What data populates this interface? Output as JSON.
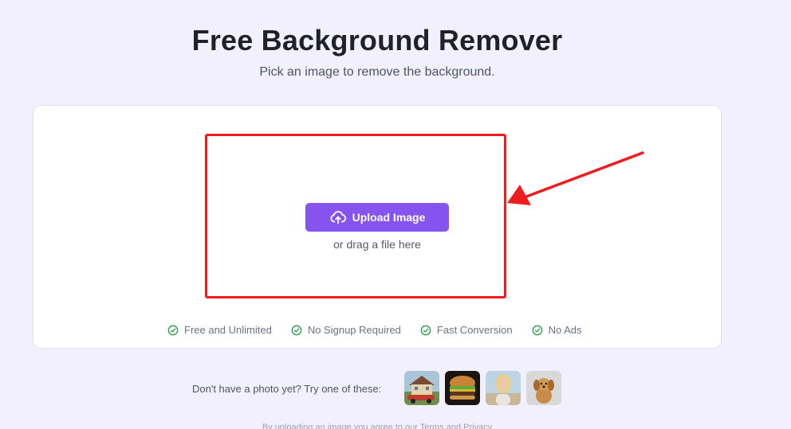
{
  "header": {
    "title": "Free Background Remover",
    "subtitle": "Pick an image to remove the background."
  },
  "upload": {
    "button_label": "Upload Image",
    "button_icon": "cloud-upload-icon",
    "drag_text": "or drag a file here"
  },
  "features": [
    {
      "label": "Free and Unlimited",
      "icon": "check-circle-icon"
    },
    {
      "label": "No Signup Required",
      "icon": "check-circle-icon"
    },
    {
      "label": "Fast Conversion",
      "icon": "check-circle-icon"
    },
    {
      "label": "No Ads",
      "icon": "check-circle-icon"
    }
  ],
  "samples": {
    "prompt": "Don't have a photo yet? Try one of these:",
    "images": [
      "house-with-red-car",
      "burger",
      "woman-portrait",
      "puppy"
    ]
  },
  "footer": {
    "note": "By uploading an image you agree to our Terms and Privacy"
  },
  "colors": {
    "background": "#f3f0fd",
    "accent": "#8653ee",
    "annotation_red": "#ee1c1c",
    "check_green": "#2e9a4a"
  }
}
